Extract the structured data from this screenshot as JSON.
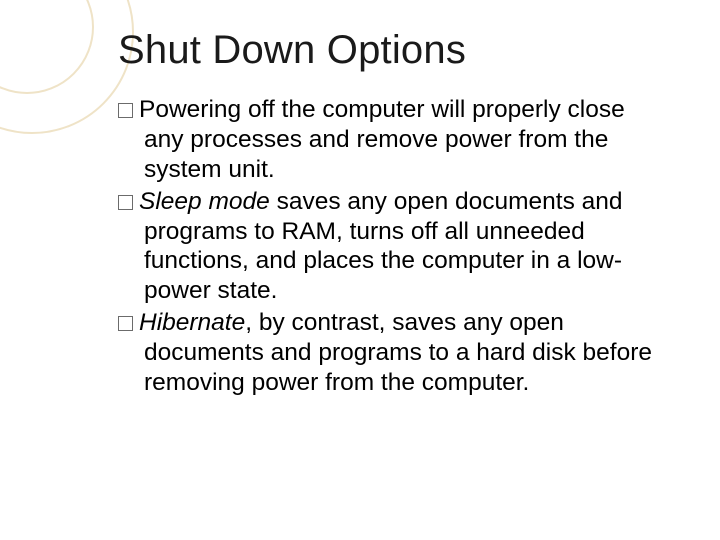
{
  "title": "Shut Down Options",
  "bullets": [
    {
      "lead": "Powering",
      "rest": " off the computer will properly close any processes and remove power from the system unit.",
      "leadItalic": false
    },
    {
      "lead": "Sleep mode",
      "rest": " saves any open documents and programs to RAM, turns off all unneeded functions, and places the computer in a low-power state.",
      "leadItalic": true
    },
    {
      "lead": "Hibernate",
      "rest": ", by contrast, saves any open documents and programs to a hard disk before removing power from the computer.",
      "leadItalic": true
    }
  ]
}
